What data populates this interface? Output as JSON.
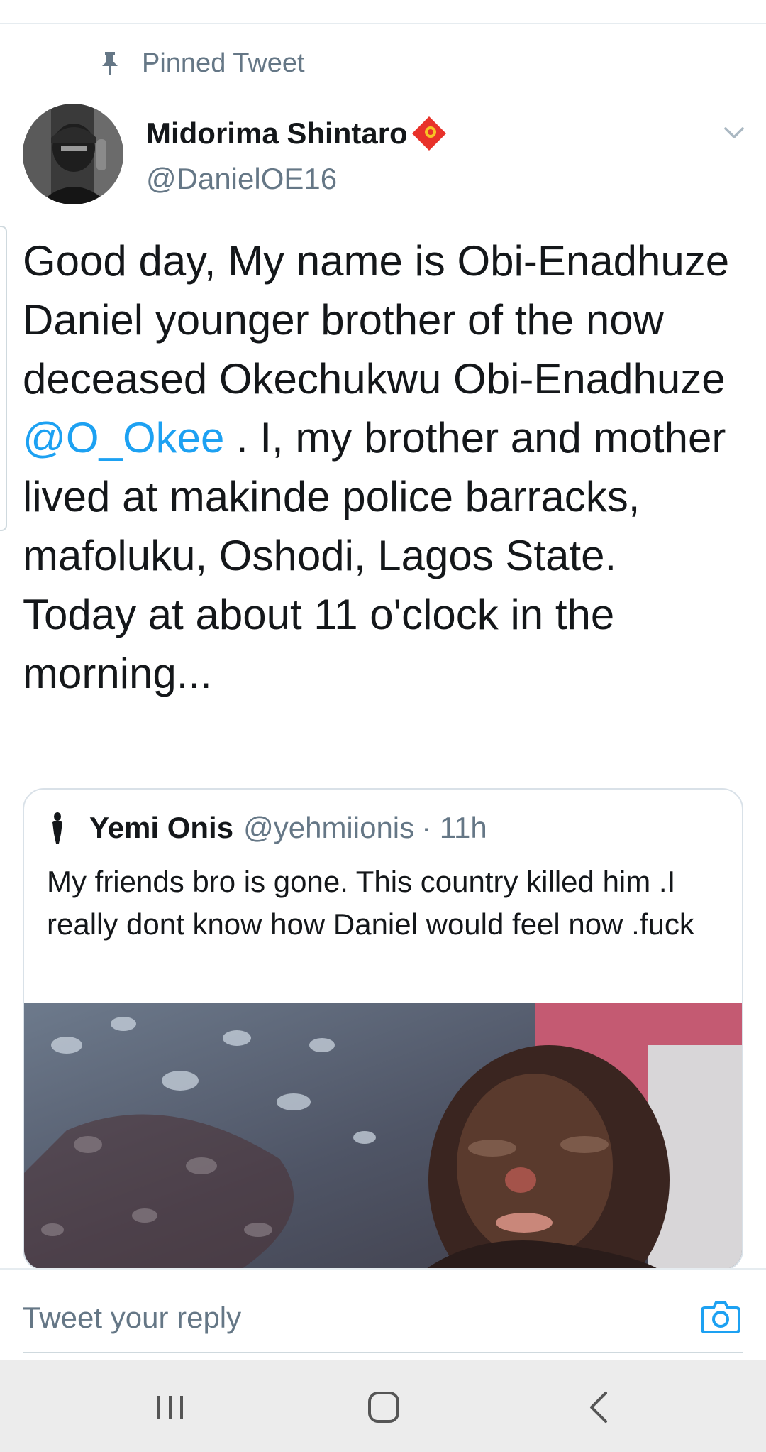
{
  "pinned": {
    "label": "Pinned Tweet",
    "icon": "pin-icon"
  },
  "author": {
    "name": "Midorima Shintaro",
    "handle": "@DanielOE16",
    "badge_icon": "flag-icon",
    "avatar": "avatar"
  },
  "tweet": {
    "text_before": "Good day, My name is Obi-Enadhuze Daniel younger brother of the now deceased Okechukwu Obi-Enadhuze ",
    "mention": "@O_Okee",
    "text_after": " . I, my brother and mother lived at makinde police barracks, mafoluku, Oshodi, Lagos State. Today at about 11 o'clock in the morning...",
    "menu_icon": "chevron-down-icon"
  },
  "quote": {
    "name": "Yemi Onis",
    "handle": "@yehmiionis",
    "time": "· 11h",
    "text": "My friends bro is gone. This country killed him .I really dont know how Daniel would feel now .fuck"
  },
  "reply": {
    "placeholder": "Tweet your reply",
    "camera_icon": "camera-icon"
  },
  "nav": {
    "recents_icon": "recents-icon",
    "home_icon": "home-icon",
    "back_icon": "back-icon"
  },
  "colors": {
    "accent": "#1da1f2",
    "secondary_text": "#657786",
    "primary_text": "#14171a"
  }
}
